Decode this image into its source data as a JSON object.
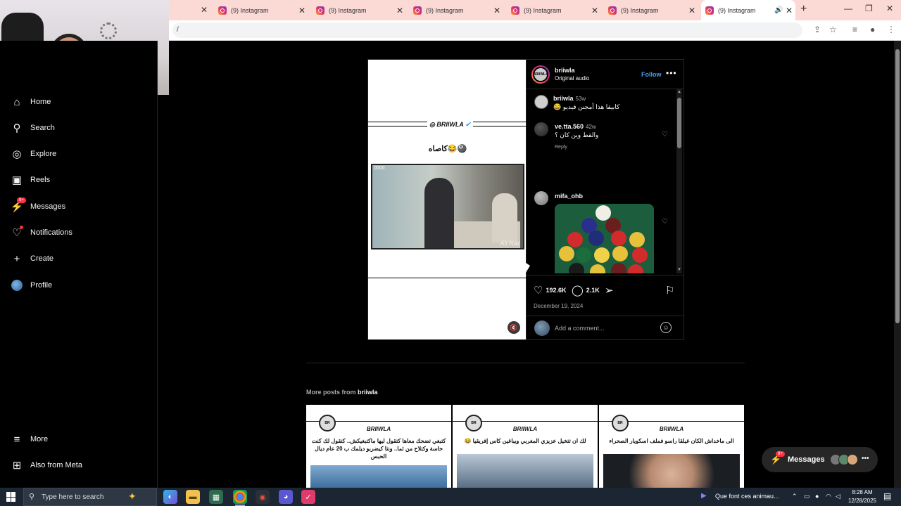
{
  "browser": {
    "tabs": [
      {
        "title": "(9) Instagram"
      },
      {
        "title": "(9) Instagram"
      },
      {
        "title": "(9) Instagram"
      },
      {
        "title": "(9) Instagram"
      },
      {
        "title": "(9) Instagram"
      },
      {
        "title": "(9) Instagram"
      }
    ],
    "address": "/",
    "colors": {
      "tabbar": "#fbdad6",
      "active_tab": "#ffffff"
    }
  },
  "sidebar": {
    "items": [
      {
        "label": "Home",
        "icon": "home-icon"
      },
      {
        "label": "Search",
        "icon": "search-icon"
      },
      {
        "label": "Explore",
        "icon": "compass-icon"
      },
      {
        "label": "Reels",
        "icon": "reels-icon"
      },
      {
        "label": "Messages",
        "icon": "messenger-icon",
        "badge": "9+"
      },
      {
        "label": "Notifications",
        "icon": "heart-icon"
      },
      {
        "label": "Create",
        "icon": "plus-icon"
      },
      {
        "label": "Profile",
        "icon": "avatar"
      }
    ],
    "bottom": [
      {
        "label": "More",
        "icon": "hamburger-icon"
      },
      {
        "label": "Also from Meta",
        "icon": "meta-icon"
      }
    ]
  },
  "post": {
    "author": "briiwla",
    "audio": "Original audio",
    "follow_label": "Follow",
    "media": {
      "brand": "BRIIWLA",
      "caption": "كاصاه😂🎱",
      "watermark": "Ali Naz",
      "timestamp": "0000"
    },
    "comments": [
      {
        "user": "briiwla",
        "time": "53w",
        "text": "كابيقا هذا أمجنن فيديو 😂"
      },
      {
        "user": "ve.tta.560",
        "time": "42w",
        "text": "والقط وين كان ؟",
        "reply": "Reply"
      },
      {
        "user": "mifa_ohb",
        "time": "",
        "text": ""
      }
    ],
    "likes": "192.6K",
    "comment_count": "2.1K",
    "date": "December 19, 2024",
    "add_comment_placeholder": "Add a comment..."
  },
  "more_posts": {
    "prefix": "More posts from",
    "user": "briiwla",
    "items": [
      {
        "brand": "BRIIWLA",
        "text": "كتبغي تضحك معاها كتقول ليها ماكتبغيكش.. كتقول لك كنت حاسة وكتلاح من ثما.. ونتا كيضربو ديلمك ب 20 عام ديال الحبس"
      },
      {
        "brand": "BRIIWLA",
        "text": "لك ان تتخيل عزيزي المغربي ويباغين كاس إفريقيا 😂"
      },
      {
        "brand": "BRIIWLA",
        "text": "الى ماخداش الكان غيلقا راسو فملف اسكويار الصحراء"
      }
    ]
  },
  "messages_pill": {
    "label": "Messages",
    "badge": "9+"
  },
  "taskbar": {
    "search_placeholder": "Type here to search",
    "notification_text": "Que font ces animau...",
    "time": "8:28 AM",
    "date": "12/28/2025"
  }
}
